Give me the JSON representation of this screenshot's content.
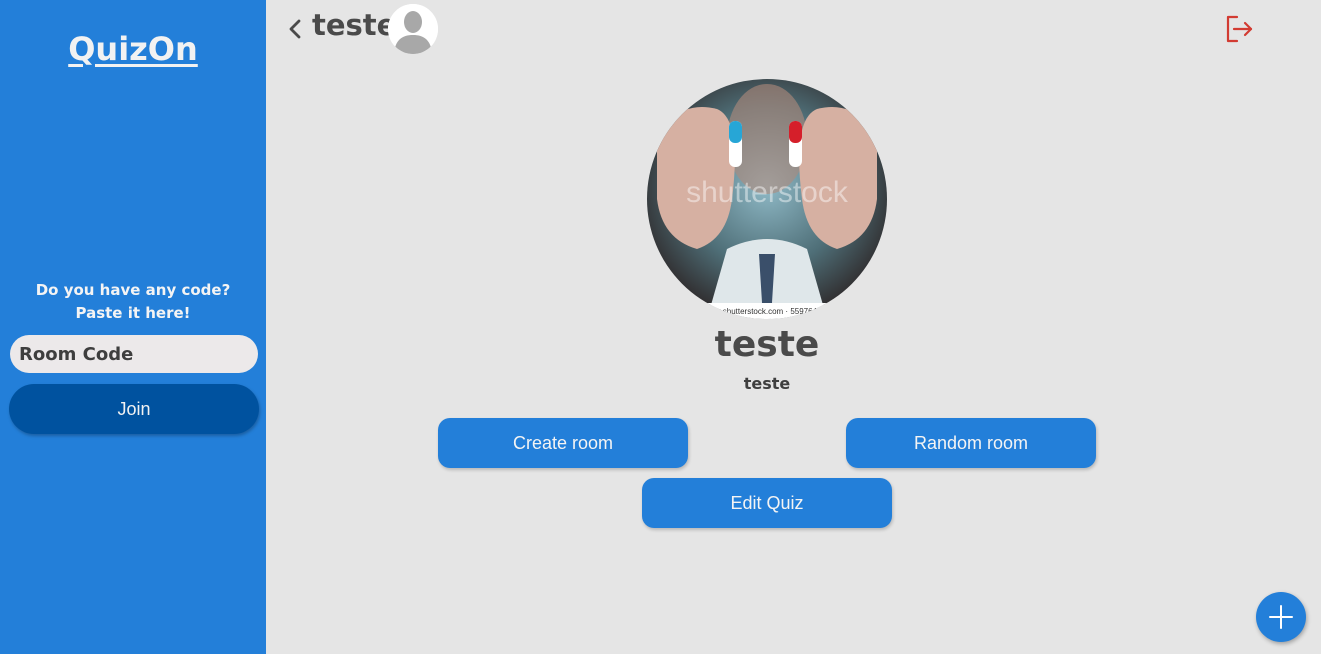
{
  "sidebar": {
    "logo": "QuizOn",
    "code_prompt_line1": "Do you have any code?",
    "code_prompt_line2": "Paste it here!",
    "room_code_placeholder": "Room Code",
    "join_label": "Join"
  },
  "header": {
    "title": "teste",
    "back_icon": "chevron-left-icon",
    "logout_icon": "logout-icon"
  },
  "profile": {
    "name": "teste",
    "username": "teste",
    "watermark": "shutterstock",
    "watermark_url": "www.shutterstock.com · 559764574"
  },
  "actions": {
    "create_room": "Create room",
    "random_room": "Random room",
    "edit_quiz": "Edit Quiz"
  },
  "fab": {
    "icon": "plus-icon"
  },
  "colors": {
    "primary": "#237fd9",
    "primary_dark": "#00529f",
    "background": "#e5e5e5",
    "logout_red": "#d23b32"
  }
}
